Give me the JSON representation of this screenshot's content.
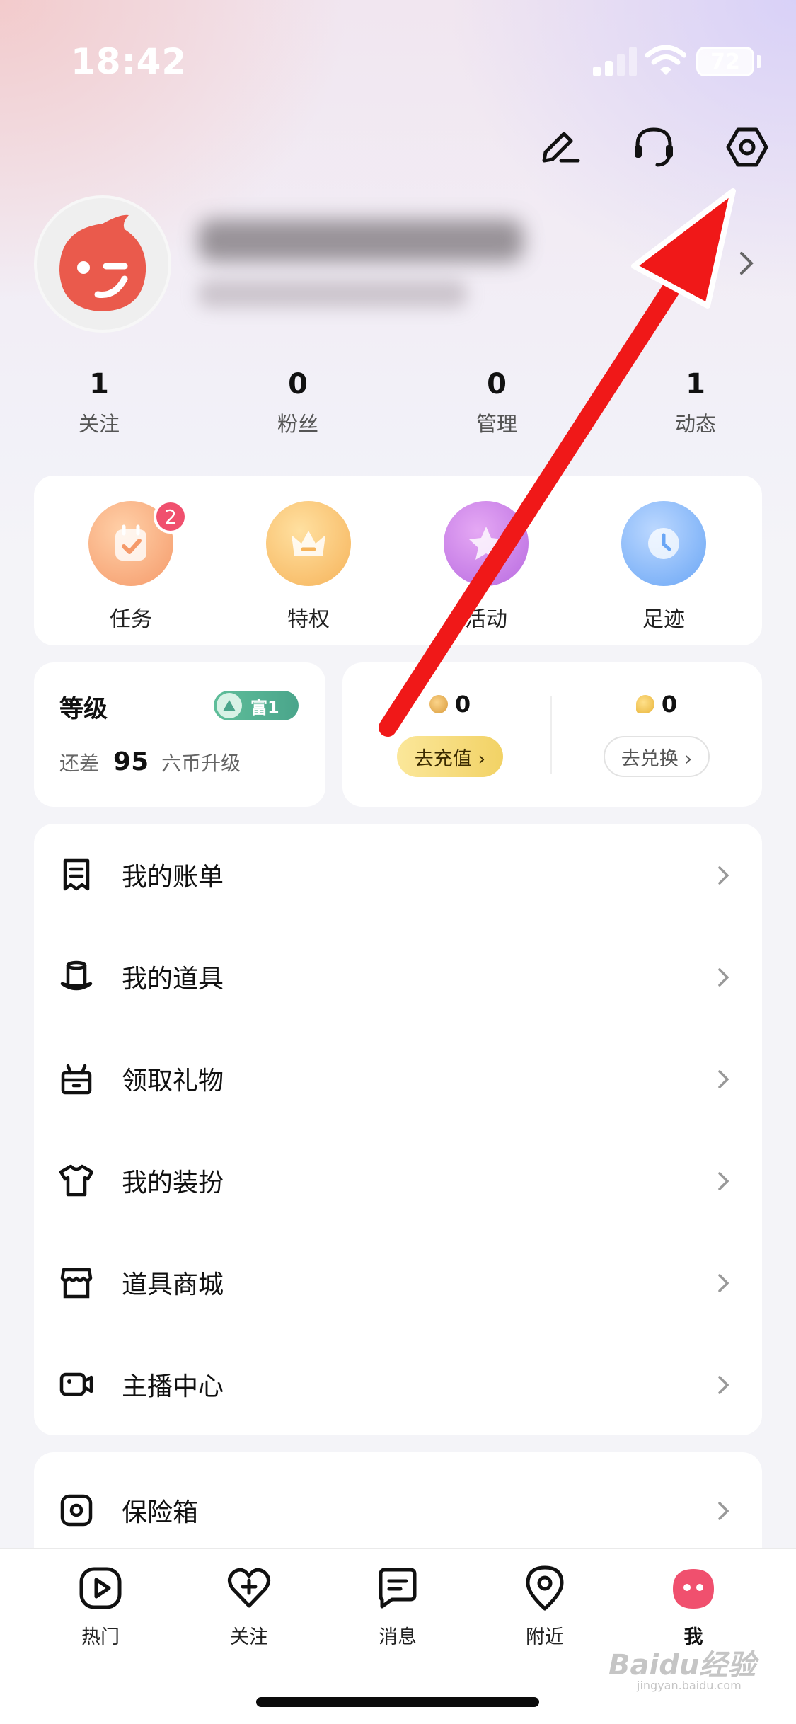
{
  "status_bar": {
    "time": "18:42",
    "battery": "72"
  },
  "header": {
    "icons": [
      "edit-icon",
      "headset-icon",
      "settings-icon"
    ]
  },
  "profile": {
    "avatar": "wink-face-avatar"
  },
  "stats": [
    {
      "value": "1",
      "label": "关注"
    },
    {
      "value": "0",
      "label": "粉丝"
    },
    {
      "value": "0",
      "label": "管理"
    },
    {
      "value": "1",
      "label": "动态"
    }
  ],
  "quick_actions": [
    {
      "label": "任务",
      "badge": "2",
      "icon": "task-icon"
    },
    {
      "label": "特权",
      "icon": "crown-icon"
    },
    {
      "label": "活动",
      "icon": "star-icon"
    },
    {
      "label": "足迹",
      "icon": "clock-icon"
    }
  ],
  "level": {
    "title": "等级",
    "badge": "富1",
    "prefix": "还差",
    "amount": "95",
    "suffix": "六币升级"
  },
  "wallet": {
    "coin_value": "0",
    "coin_button": "去充值 ›",
    "bean_value": "0",
    "bean_button": "去兑换 ›"
  },
  "menu": [
    {
      "label": "我的账单",
      "icon": "bill-icon"
    },
    {
      "label": "我的道具",
      "icon": "hat-icon"
    },
    {
      "label": "领取礼物",
      "icon": "gift-icon"
    },
    {
      "label": "我的装扮",
      "icon": "shirt-icon"
    },
    {
      "label": "道具商城",
      "icon": "store-icon"
    },
    {
      "label": "主播中心",
      "icon": "camera-icon"
    }
  ],
  "safe_box": {
    "label": "保险箱",
    "icon": "safe-icon"
  },
  "tabs": [
    {
      "label": "热门",
      "icon": "play-icon"
    },
    {
      "label": "关注",
      "icon": "heart-plus-icon"
    },
    {
      "label": "消息",
      "icon": "message-icon"
    },
    {
      "label": "附近",
      "icon": "location-icon"
    },
    {
      "label": "我",
      "icon": "me-icon",
      "active": true
    }
  ],
  "watermark": {
    "main": "Baidu经验",
    "sub": "jingyan.baidu.com"
  },
  "colors": {
    "accent": "#f0506e",
    "arrow": "#f01818",
    "level_badge": "#4aa58b",
    "recharge": "#f7de7c"
  }
}
